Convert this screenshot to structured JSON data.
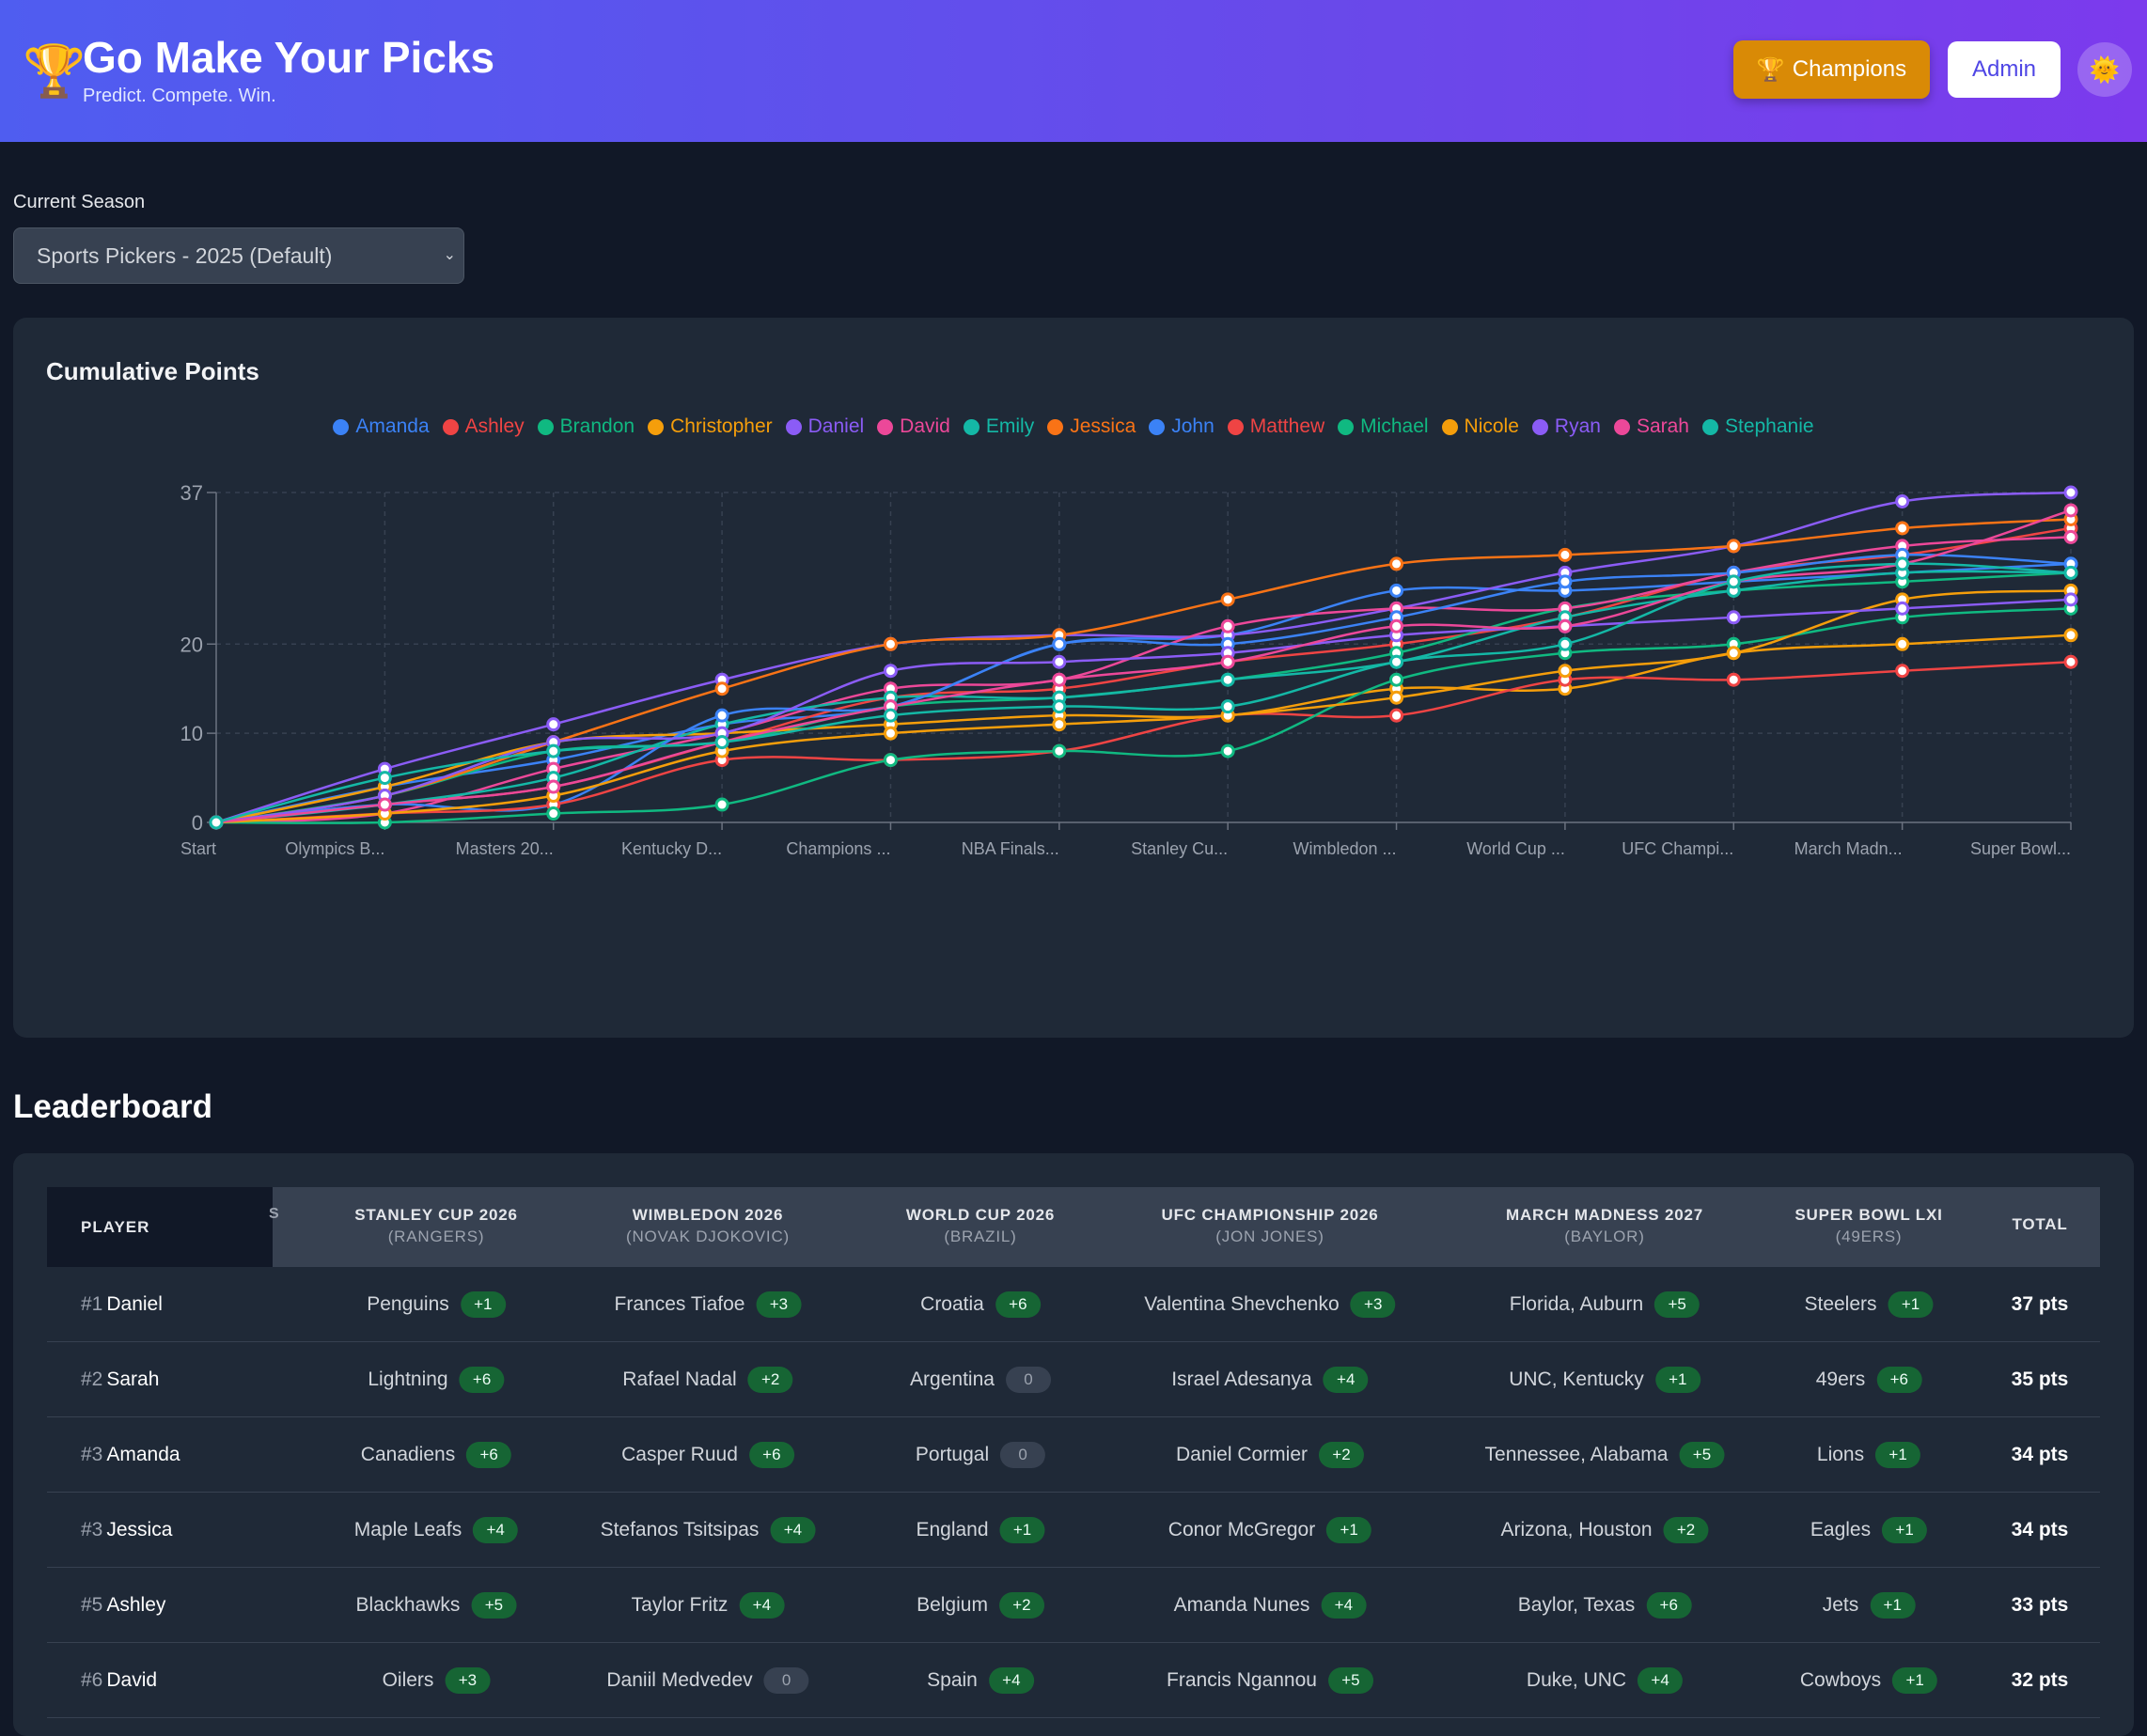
{
  "header": {
    "title": "Go Make Your Picks",
    "tagline": "Predict. Compete. Win.",
    "trophy_icon": "🏆",
    "champions_label": "Champions",
    "admin_label": "Admin",
    "theme_icon": "🌞"
  },
  "season": {
    "label": "Current Season",
    "selected": "Sports Pickers - 2025 (Default)"
  },
  "chart_card": {
    "title": "Cumulative Points"
  },
  "chart_data": {
    "type": "line",
    "title": "Cumulative Points",
    "x": [
      "Start",
      "Olympics B...",
      "Masters 20...",
      "Kentucky D...",
      "Champions ...",
      "NBA Finals...",
      "Stanley Cu...",
      "Wimbledon ...",
      "World Cup ...",
      "UFC Champi...",
      "March Madn...",
      "Super Bowl..."
    ],
    "yticks": [
      0,
      10,
      20,
      37
    ],
    "ylim": [
      0,
      37
    ],
    "grid": true,
    "legend_position": "top-center",
    "series": [
      {
        "name": "Amanda",
        "color": "#3b82f6",
        "values": [
          0,
          4,
          7,
          11,
          13,
          20,
          21,
          26,
          26,
          27,
          28,
          29
        ]
      },
      {
        "name": "Ashley",
        "color": "#ef4444",
        "values": [
          0,
          2,
          4,
          9,
          14,
          15,
          18,
          20,
          23,
          28,
          30,
          33
        ]
      },
      {
        "name": "Brandon",
        "color": "#10b981",
        "values": [
          0,
          3,
          8,
          9,
          13,
          14,
          16,
          19,
          24,
          26,
          27,
          28
        ]
      },
      {
        "name": "Christopher",
        "color": "#f59e0b",
        "values": [
          0,
          4,
          9,
          10,
          11,
          12,
          12,
          15,
          15,
          19,
          20,
          21
        ]
      },
      {
        "name": "Daniel",
        "color": "#8b5cf6",
        "values": [
          0,
          6,
          11,
          16,
          20,
          21,
          21,
          24,
          28,
          31,
          36,
          37
        ]
      },
      {
        "name": "David",
        "color": "#ec4899",
        "values": [
          0,
          1,
          6,
          10,
          15,
          16,
          22,
          24,
          24,
          28,
          31,
          32
        ]
      },
      {
        "name": "Emily",
        "color": "#14b8a6",
        "values": [
          0,
          2,
          5,
          11,
          14,
          14,
          16,
          18,
          23,
          26,
          28,
          28
        ]
      },
      {
        "name": "Jessica",
        "color": "#f97316",
        "values": [
          0,
          3,
          9,
          15,
          20,
          21,
          25,
          29,
          30,
          31,
          33,
          34
        ]
      },
      {
        "name": "John",
        "color": "#3b82f6",
        "values": [
          0,
          2,
          2,
          12,
          13,
          20,
          20,
          23,
          27,
          28,
          30,
          29
        ]
      },
      {
        "name": "Matthew",
        "color": "#ef4444",
        "values": [
          0,
          1,
          2,
          7,
          7,
          8,
          12,
          12,
          16,
          16,
          17,
          18
        ]
      },
      {
        "name": "Michael",
        "color": "#10b981",
        "values": [
          0,
          0,
          1,
          2,
          7,
          8,
          8,
          16,
          19,
          20,
          23,
          24
        ]
      },
      {
        "name": "Nicole",
        "color": "#f59e0b",
        "values": [
          0,
          1,
          3,
          8,
          10,
          11,
          12,
          14,
          17,
          19,
          25,
          26
        ]
      },
      {
        "name": "Ryan",
        "color": "#8b5cf6",
        "values": [
          0,
          3,
          9,
          10,
          17,
          18,
          19,
          21,
          22,
          23,
          24,
          25
        ]
      },
      {
        "name": "Sarah",
        "color": "#ec4899",
        "values": [
          0,
          2,
          4,
          9,
          13,
          16,
          18,
          22,
          22,
          27,
          29,
          35
        ]
      },
      {
        "name": "Stephanie",
        "color": "#14b8a6",
        "values": [
          0,
          5,
          8,
          9,
          12,
          13,
          13,
          18,
          20,
          27,
          29,
          28
        ]
      }
    ]
  },
  "leaderboard": {
    "title": "Leaderboard",
    "player_header": "PLAYER",
    "peek_header": "S",
    "total_header": "TOTAL",
    "columns": [
      {
        "name": "STANLEY CUP 2026",
        "answer": "(RANGERS)"
      },
      {
        "name": "WIMBLEDON 2026",
        "answer": "(NOVAK DJOKOVIC)"
      },
      {
        "name": "WORLD CUP 2026",
        "answer": "(BRAZIL)"
      },
      {
        "name": "UFC CHAMPIONSHIP 2026",
        "answer": "(JON JONES)"
      },
      {
        "name": "MARCH MADNESS 2027",
        "answer": "(BAYLOR)"
      },
      {
        "name": "SUPER BOWL LXI",
        "answer": "(49ERS)"
      }
    ],
    "rows": [
      {
        "rank": "#1",
        "name": "Daniel",
        "total": "37 pts",
        "picks": [
          {
            "pick": "Penguins",
            "pts": "+1"
          },
          {
            "pick": "Frances Tiafoe",
            "pts": "+3"
          },
          {
            "pick": "Croatia",
            "pts": "+6"
          },
          {
            "pick": "Valentina Shevchenko",
            "pts": "+3"
          },
          {
            "pick": "Florida, Auburn",
            "pts": "+5"
          },
          {
            "pick": "Steelers",
            "pts": "+1"
          }
        ]
      },
      {
        "rank": "#2",
        "name": "Sarah",
        "total": "35 pts",
        "picks": [
          {
            "pick": "Lightning",
            "pts": "+6"
          },
          {
            "pick": "Rafael Nadal",
            "pts": "+2"
          },
          {
            "pick": "Argentina",
            "pts": "0"
          },
          {
            "pick": "Israel Adesanya",
            "pts": "+4"
          },
          {
            "pick": "UNC, Kentucky",
            "pts": "+1"
          },
          {
            "pick": "49ers",
            "pts": "+6"
          }
        ]
      },
      {
        "rank": "#3",
        "name": "Amanda",
        "total": "34 pts",
        "picks": [
          {
            "pick": "Canadiens",
            "pts": "+6"
          },
          {
            "pick": "Casper Ruud",
            "pts": "+6"
          },
          {
            "pick": "Portugal",
            "pts": "0"
          },
          {
            "pick": "Daniel Cormier",
            "pts": "+2"
          },
          {
            "pick": "Tennessee, Alabama",
            "pts": "+5"
          },
          {
            "pick": "Lions",
            "pts": "+1"
          }
        ]
      },
      {
        "rank": "#3",
        "name": "Jessica",
        "total": "34 pts",
        "picks": [
          {
            "pick": "Maple Leafs",
            "pts": "+4"
          },
          {
            "pick": "Stefanos Tsitsipas",
            "pts": "+4"
          },
          {
            "pick": "England",
            "pts": "+1"
          },
          {
            "pick": "Conor McGregor",
            "pts": "+1"
          },
          {
            "pick": "Arizona, Houston",
            "pts": "+2"
          },
          {
            "pick": "Eagles",
            "pts": "+1"
          }
        ]
      },
      {
        "rank": "#5",
        "name": "Ashley",
        "total": "33 pts",
        "picks": [
          {
            "pick": "Blackhawks",
            "pts": "+5"
          },
          {
            "pick": "Taylor Fritz",
            "pts": "+4"
          },
          {
            "pick": "Belgium",
            "pts": "+2"
          },
          {
            "pick": "Amanda Nunes",
            "pts": "+4"
          },
          {
            "pick": "Baylor, Texas",
            "pts": "+6"
          },
          {
            "pick": "Jets",
            "pts": "+1"
          }
        ]
      },
      {
        "rank": "#6",
        "name": "David",
        "total": "32 pts",
        "picks": [
          {
            "pick": "Oilers",
            "pts": "+3"
          },
          {
            "pick": "Daniil Medvedev",
            "pts": "0"
          },
          {
            "pick": "Spain",
            "pts": "+4"
          },
          {
            "pick": "Francis Ngannou",
            "pts": "+5"
          },
          {
            "pick": "Duke, UNC",
            "pts": "+4"
          },
          {
            "pick": "Cowboys",
            "pts": "+1"
          }
        ]
      }
    ]
  }
}
